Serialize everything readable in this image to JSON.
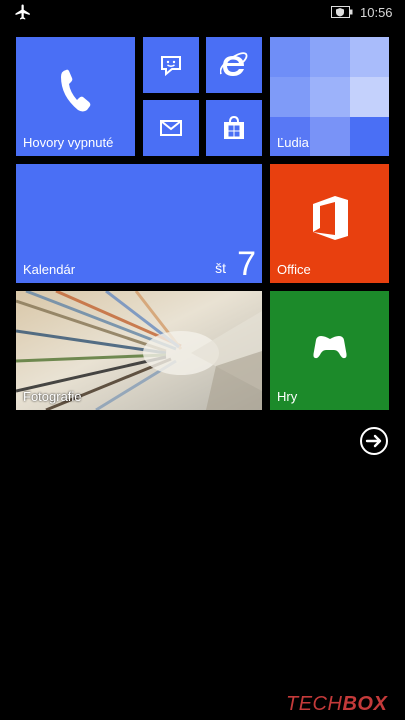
{
  "statusbar": {
    "time": "10:56",
    "icons": [
      "airplane-mode-icon",
      "battery-saver-icon"
    ]
  },
  "tiles": {
    "phone": {
      "label": "Hovory vypnuté",
      "icon": "phone-icon"
    },
    "messaging": {
      "icon": "messaging-icon"
    },
    "ie": {
      "icon": "internet-explorer-icon"
    },
    "mail": {
      "icon": "mail-icon"
    },
    "store": {
      "icon": "store-icon"
    },
    "people": {
      "label": "Ľudia"
    },
    "calendar": {
      "label": "Kalendár",
      "day": "št",
      "date": "7"
    },
    "office": {
      "label": "Office",
      "icon": "office-icon"
    },
    "photos": {
      "label": "Fotografie"
    },
    "games": {
      "label": "Hry",
      "icon": "xbox-controller-icon"
    }
  },
  "all_apps_button": {
    "icon": "arrow-right-circle-icon"
  },
  "watermark": {
    "part1": "TECH",
    "part2": "BOX"
  },
  "colors": {
    "tile_blue": "#4a6ff5",
    "office_orange": "#e8400f",
    "games_green": "#1c8a2a",
    "background": "#000000",
    "watermark": "#c43a3a"
  }
}
